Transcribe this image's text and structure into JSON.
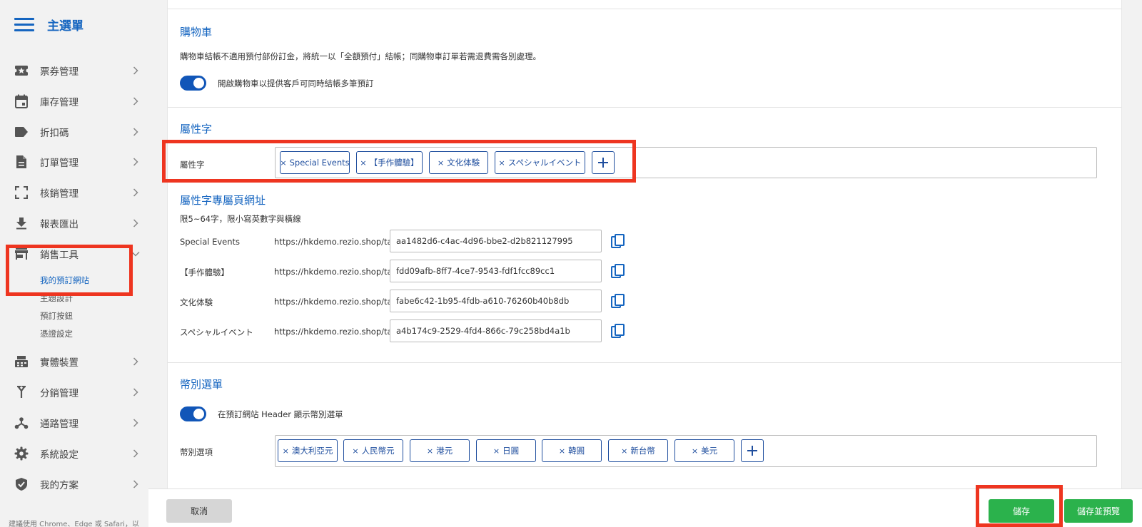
{
  "sidebar": {
    "title": "主選單",
    "items": [
      {
        "label": "票券管理",
        "icon": "ticket-star-icon"
      },
      {
        "label": "庫存管理",
        "icon": "calendar-icon"
      },
      {
        "label": "折扣碼",
        "icon": "label-tag-icon"
      },
      {
        "label": "訂單管理",
        "icon": "document-icon"
      },
      {
        "label": "核銷管理",
        "icon": "scan-frame-icon"
      },
      {
        "label": "報表匯出",
        "icon": "download-icon"
      },
      {
        "label": "銷售工具",
        "icon": "storefront-icon"
      },
      {
        "label": "實體裝置",
        "icon": "pos-terminal-icon"
      },
      {
        "label": "分銷管理",
        "icon": "fork-icon"
      },
      {
        "label": "通路管理",
        "icon": "network-icon"
      },
      {
        "label": "系統設定",
        "icon": "gear-icon"
      },
      {
        "label": "我的方案",
        "icon": "shield-check-icon"
      }
    ],
    "subitems": [
      "我的預訂網站",
      "主題設計",
      "預訂按鈕",
      "憑證設定"
    ],
    "footer": "建議使用 Chrome、Edge 或 Safari，以"
  },
  "cart": {
    "title": "購物車",
    "description": "購物車結帳不適用預付部份訂金，將統一以「全額預付」結帳；同購物車訂單若需退費需各別處理。",
    "toggle_label": "開啟購物車以提供客戶可同時結帳多筆預訂"
  },
  "attributes": {
    "title": "屬性字",
    "field_label": "屬性字",
    "tags": [
      "Special Events",
      "【手作體驗】",
      "文化体験",
      "スペシャルイベント"
    ],
    "remove_symbol": "×"
  },
  "tag_urls": {
    "title": "屬性字專屬頁網址",
    "hint": "限5~64字，限小寫英數字與橫線",
    "prefix": "https://hkdemo.rezio.shop/tag/",
    "rows": [
      {
        "label": "Special Events",
        "slug": "aa1482d6-c4ac-4d96-bbe2-d2b821127995"
      },
      {
        "label": "【手作體驗】",
        "slug": "fdd09afb-8ff7-4ce7-9543-fdf1fcc89cc1"
      },
      {
        "label": "文化体験",
        "slug": "fabe6c42-1b95-4fdb-a610-76260b40b8db"
      },
      {
        "label": "スペシャルイベント",
        "slug": "a4b174c9-2529-4fd4-866c-79c258bd4a1b"
      }
    ]
  },
  "currency": {
    "title": "幣別選單",
    "toggle_label": "在預訂網站 Header 顯示幣別選單",
    "field_label": "幣別選項",
    "tags": [
      "澳大利亞元",
      "人民幣元",
      "港元",
      "日圓",
      "韓圓",
      "新台幣",
      "美元"
    ]
  },
  "actions": {
    "cancel": "取消",
    "save": "儲存",
    "save_preview": "儲存並預覽"
  },
  "colors": {
    "accent": "#1565c0",
    "save_green": "#2bb24c",
    "highlight_red": "#ee3520"
  }
}
